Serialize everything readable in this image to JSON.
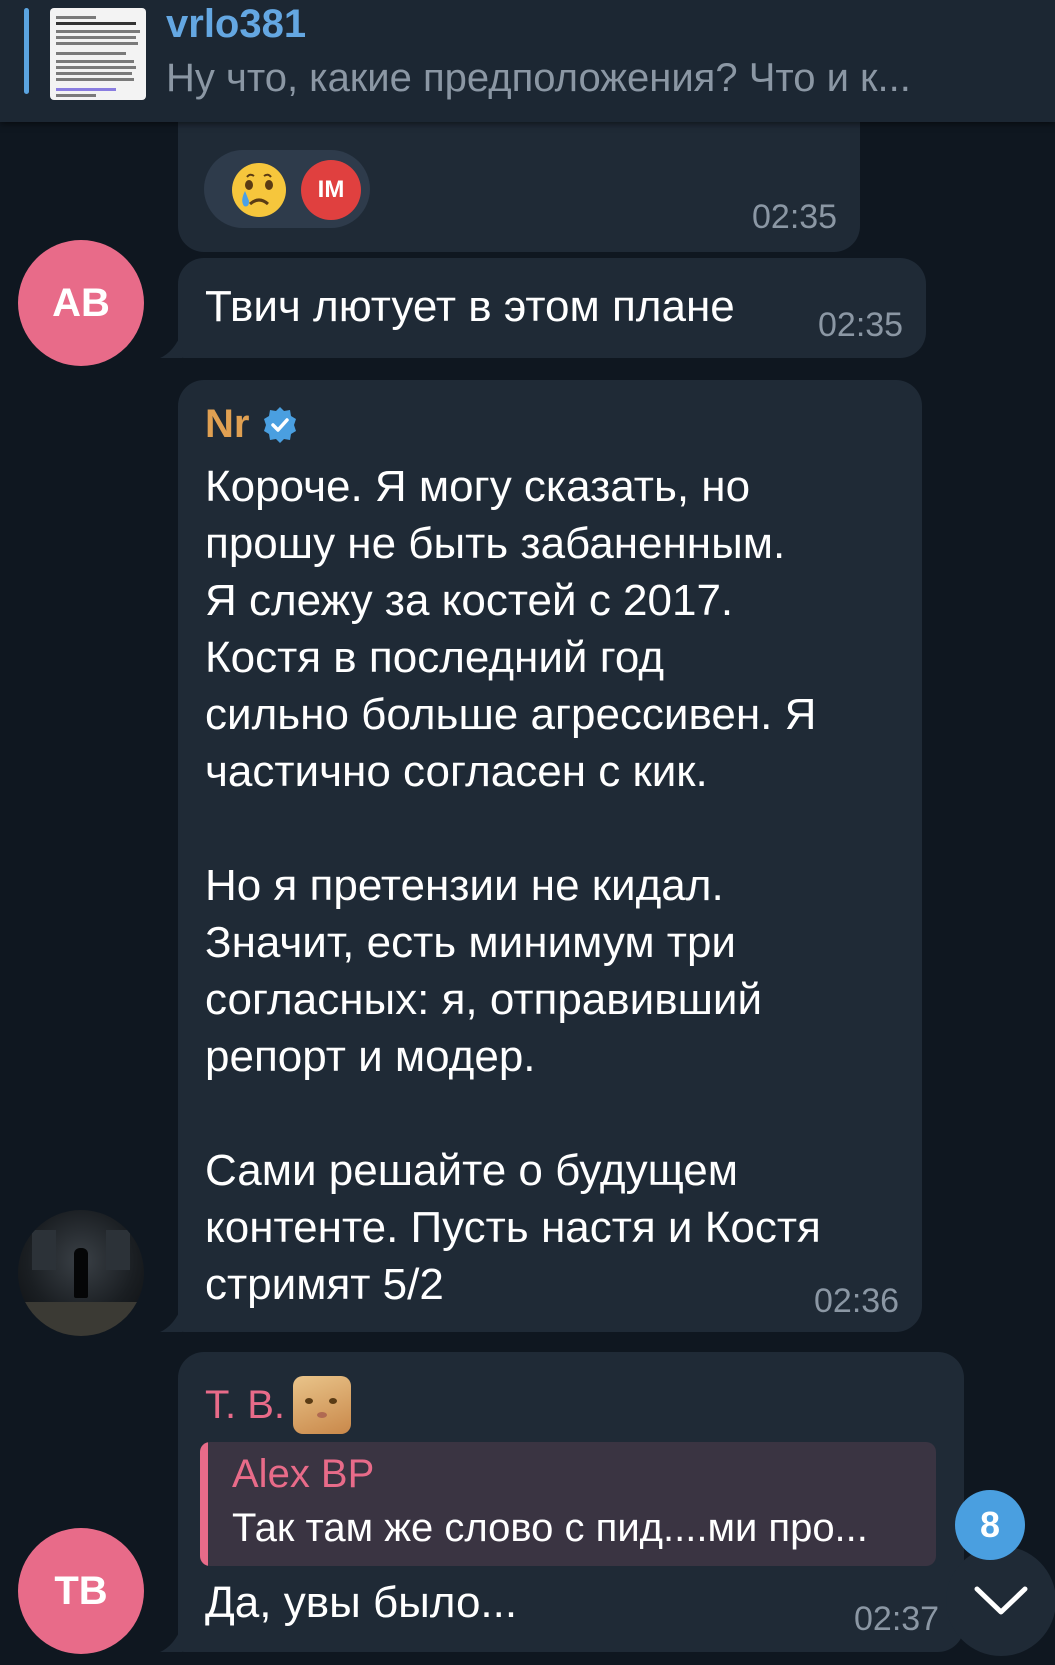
{
  "pinned": {
    "title": "vrlo381",
    "preview": "Ну что, какие предположения? Что и к..."
  },
  "messages": [
    {
      "id": "m0",
      "time": "02:35",
      "reactions": [
        {
          "type": "emoji",
          "icon": "crying-face-icon"
        },
        {
          "type": "avatar",
          "initials": "IM",
          "color": "#e0403f"
        }
      ]
    },
    {
      "id": "m1",
      "avatar": {
        "initials": "AB",
        "color": "#e86b89"
      },
      "text": "Твич лютует в этом плане",
      "time": "02:35"
    },
    {
      "id": "m2",
      "sender": "Nr",
      "sender_color": "#e0a052",
      "verified": true,
      "lines": [
        "Короче. Я могу сказать, но",
        "прошу не быть забаненным.",
        "Я слежу за костей с 2017.",
        "Костя в последний год",
        "сильно больше агрессивен. Я",
        "частично согласен с кик.",
        "",
        "Но я претензии не кидал.",
        "Значит, есть минимум три",
        "согласных: я, отправивший",
        "репорт и модер.",
        "",
        "Сами решайте о будущем",
        "контенте. Пусть настя и Костя",
        "стримят 5/2"
      ],
      "time": "02:36"
    },
    {
      "id": "m3",
      "avatar": {
        "initials": "TB",
        "color": "#e86b89"
      },
      "sender": "T. B.",
      "sender_color": "#e86b89",
      "reply": {
        "author": "Alex BP",
        "text": "Так там же слово с пид....ми про..."
      },
      "text": "Да, увы было...",
      "time": "02:37"
    }
  ],
  "unread_count": "8",
  "colors": {
    "background": "#0f1720",
    "bubble": "#1f2a36",
    "accent": "#5ba4e0",
    "time": "#8b97a4"
  }
}
